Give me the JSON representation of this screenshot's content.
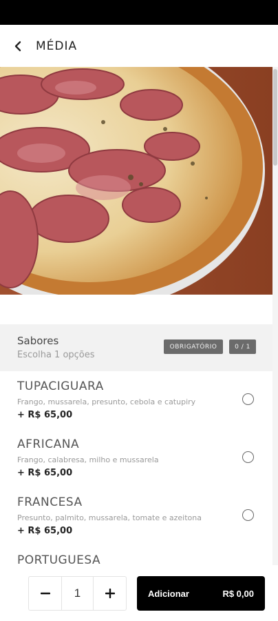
{
  "header": {
    "title": "MÉDIA",
    "back_icon": "chevron-left-icon"
  },
  "hero": {
    "image": "pizza-photo"
  },
  "section": {
    "title": "Sabores",
    "subtitle": "Escolha 1 opções",
    "badge_required": "OBRIGATÓRIO",
    "badge_count": "0 / 1"
  },
  "options": [
    {
      "name": "TUPACIGUARA",
      "description": "Frango, mussarela, presunto, cebola e catupiry",
      "price": "+ R$ 65,00",
      "selected": false
    },
    {
      "name": "AFRICANA",
      "description": "Frango, calabresa, milho e mussarela",
      "price": "+ R$ 65,00",
      "selected": false
    },
    {
      "name": "FRANCESA",
      "description": "Presunto, palmito, mussarela, tomate e azeitona",
      "price": "+ R$ 65,00",
      "selected": false
    },
    {
      "name": "PORTUGUESA",
      "description": "",
      "price": "",
      "selected": false
    }
  ],
  "footer": {
    "decrement_icon": "minus-icon",
    "increment_icon": "plus-icon",
    "quantity": "1",
    "add_label": "Adicionar",
    "total": "R$ 0,00"
  },
  "colors": {
    "primary": "#000000",
    "badge": "#6b6b6b",
    "section_bg": "#f2f2f2"
  }
}
